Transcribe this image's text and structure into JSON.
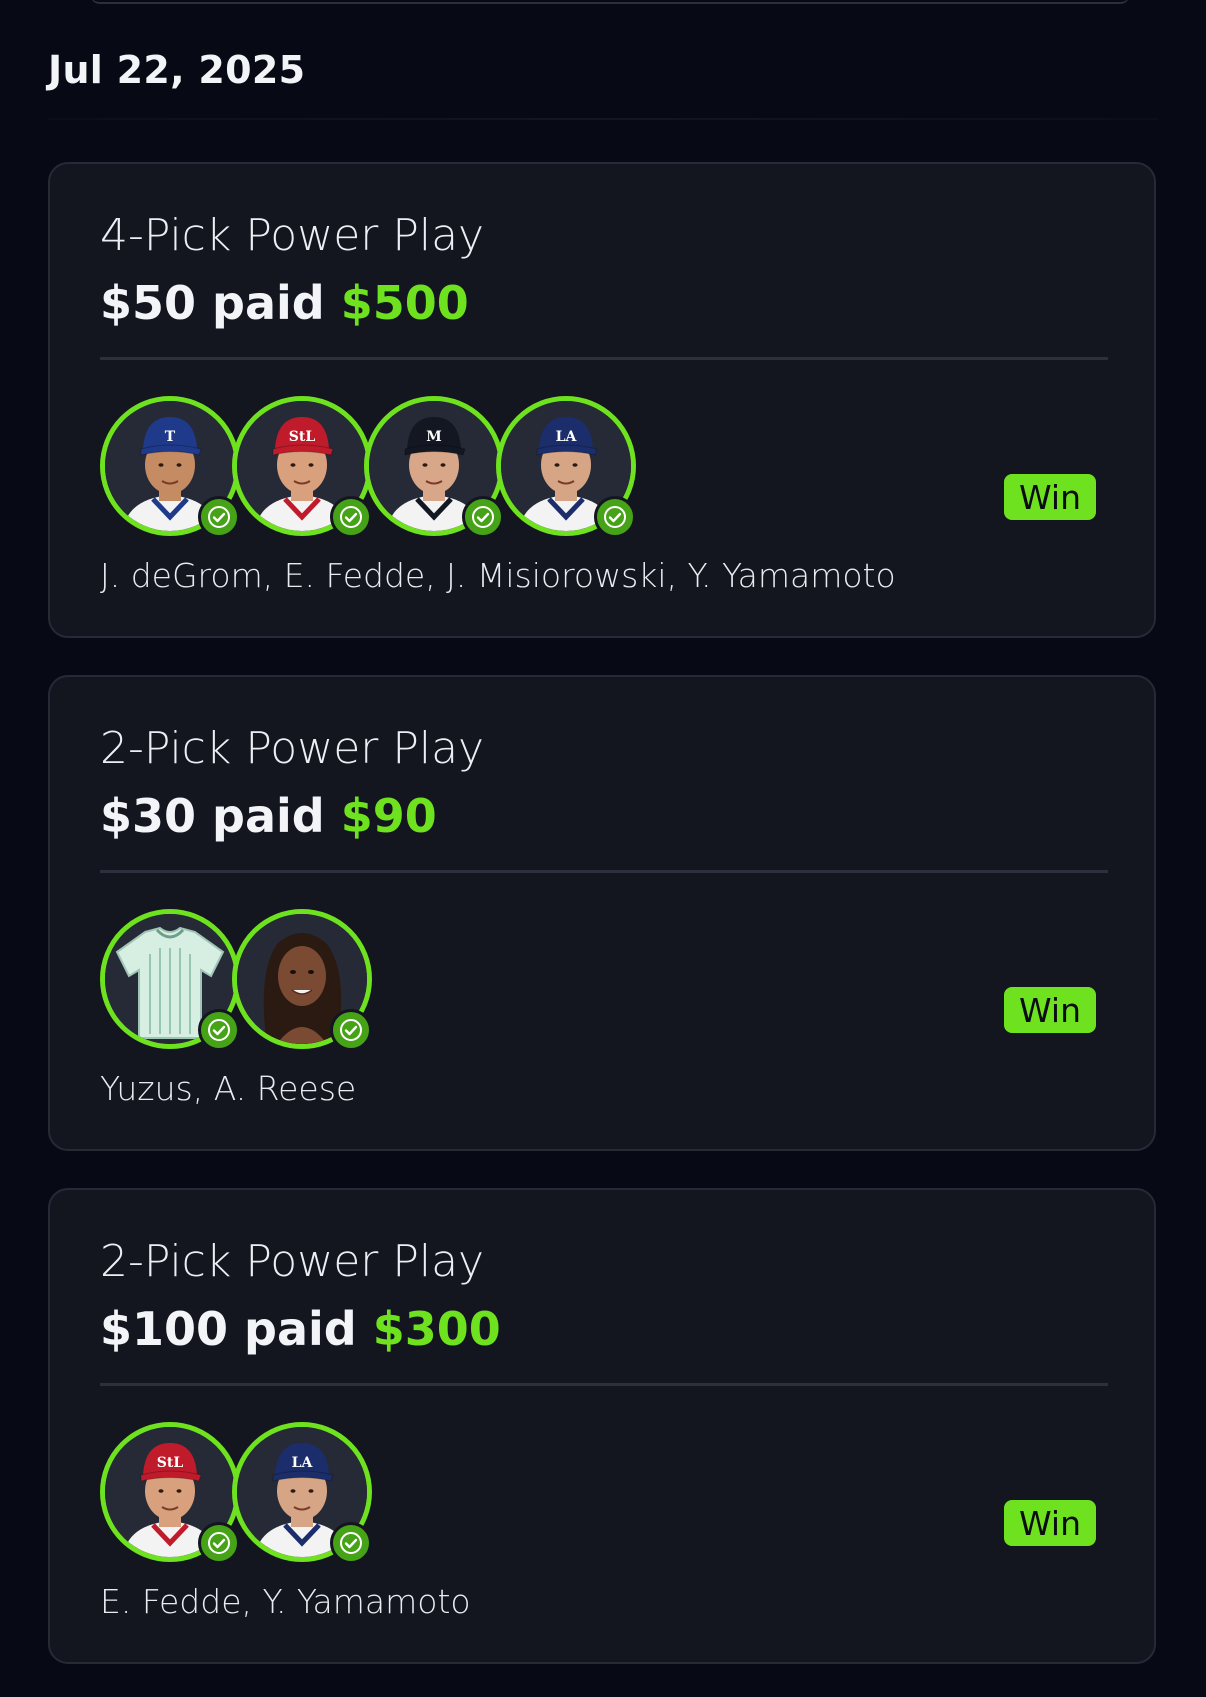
{
  "date": "Jul 22, 2025",
  "entries": [
    {
      "title": "4-Pick Power Play",
      "paid_amount": "$50 paid",
      "payout": "$500",
      "status": "Win",
      "players_line": "J. deGrom, E. Fedde, J. Misiorowski, Y. Yamamoto",
      "avatars": [
        {
          "name": "J. deGrom",
          "cap_color": "#1f3a8a",
          "cap_letter": "T",
          "shirt": "#f3f3f3",
          "skin": "#c58b63",
          "hit": true
        },
        {
          "name": "E. Fedde",
          "cap_color": "#c01b2b",
          "cap_letter": "StL",
          "shirt": "#f3f3f3",
          "skin": "#d9a07e",
          "hit": true
        },
        {
          "name": "J. Misiorowski",
          "cap_color": "#121722",
          "cap_letter": "M",
          "shirt": "#f3f3f3",
          "skin": "#d8a689",
          "hit": true
        },
        {
          "name": "Y. Yamamoto",
          "cap_color": "#1b2e6b",
          "cap_letter": "LA",
          "shirt": "#f3f3f3",
          "skin": "#d6a585",
          "hit": true
        }
      ]
    },
    {
      "title": "2-Pick Power Play",
      "paid_amount": "$30 paid",
      "payout": "$90",
      "status": "Win",
      "players_line": "Yuzus, A. Reese",
      "avatars": [
        {
          "name": "Yuzus",
          "type": "jersey",
          "shirt": "#d7efe3",
          "hit": true
        },
        {
          "name": "A. Reese",
          "type": "woman",
          "skin": "#7a4a33",
          "hair": "#2a1a12",
          "hit": true
        }
      ]
    },
    {
      "title": "2-Pick Power Play",
      "paid_amount": "$100 paid",
      "payout": "$300",
      "status": "Win",
      "players_line": "E. Fedde, Y. Yamamoto",
      "avatars": [
        {
          "name": "E. Fedde",
          "cap_color": "#c01b2b",
          "cap_letter": "StL",
          "shirt": "#f3f3f3",
          "skin": "#d9a07e",
          "hit": true
        },
        {
          "name": "Y. Yamamoto",
          "cap_color": "#1b2e6b",
          "cap_letter": "LA",
          "shirt": "#f3f3f3",
          "skin": "#d6a585",
          "hit": true
        }
      ]
    }
  ],
  "colors": {
    "accent_green": "#6ee21f",
    "background": "#070a14",
    "card": "#13151f"
  },
  "icons": {
    "check": "check-circle-icon"
  }
}
